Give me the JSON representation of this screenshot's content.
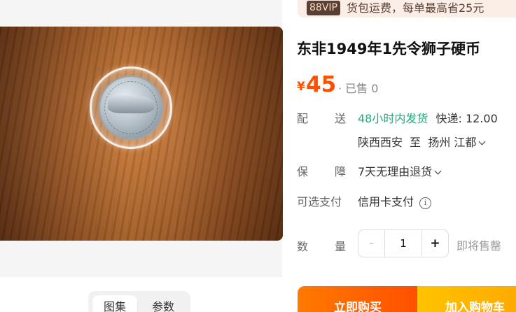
{
  "vip": {
    "badge": "88VIP",
    "text": "货包运费，每单最高省25元"
  },
  "product": {
    "title": "东非1949年1先令狮子硬币",
    "price_symbol": "¥",
    "price": "45",
    "sold": "· 已售 0"
  },
  "shipping": {
    "label": "配送",
    "speed": "48小时内发货",
    "fee": "快递: 12.00",
    "route": "陕西西安  至  扬州 江都"
  },
  "guarantee": {
    "label": "保障",
    "value": "7天无理由退货"
  },
  "payment": {
    "label": "可选支付",
    "value": "信用卡支付",
    "info_icon": "i"
  },
  "quantity": {
    "label": "数量",
    "minus": "-",
    "value": "1",
    "plus": "+",
    "stock": "即将售罄"
  },
  "actions": {
    "buy_now": "立即购买",
    "add_to_cart": "加入购物车"
  },
  "gallery": {
    "tabs": [
      "图集",
      "参数"
    ]
  },
  "colors": {
    "price": "#ff5000",
    "shipping_green": "#1aad7a",
    "buy_button": "#ff5000",
    "cart_button": "#ffa700"
  }
}
